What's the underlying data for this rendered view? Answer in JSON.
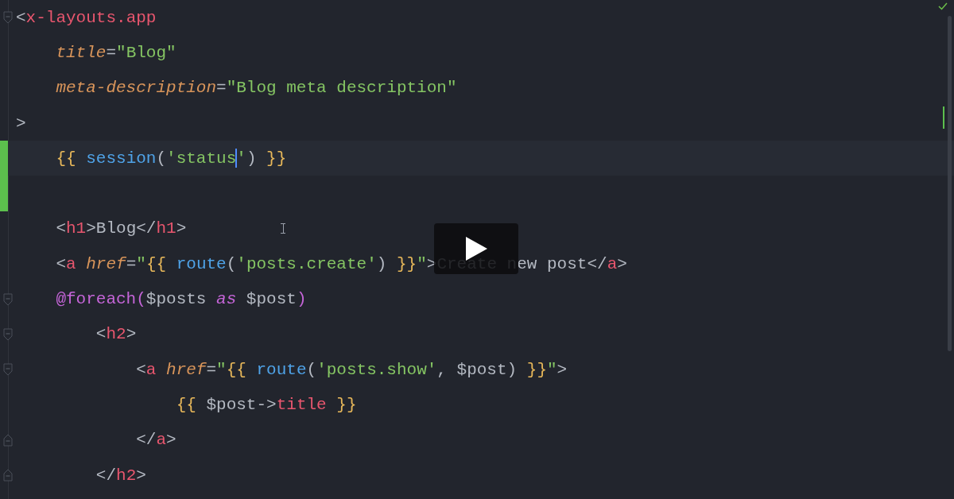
{
  "editor": {
    "lines": [
      {
        "current": false,
        "modified": false,
        "fold_start": true,
        "fold_end": false,
        "tokens": [
          {
            "kind": "punct",
            "text": "<"
          },
          {
            "kind": "tag",
            "text": "x-layouts.app"
          }
        ]
      },
      {
        "current": false,
        "modified": false,
        "fold_start": false,
        "fold_end": false,
        "tokens": [
          {
            "kind": "attr",
            "text": "    title"
          },
          {
            "kind": "punct",
            "text": "="
          },
          {
            "kind": "string",
            "text": "\"Blog\""
          }
        ]
      },
      {
        "current": false,
        "modified": false,
        "fold_start": false,
        "fold_end": false,
        "tokens": [
          {
            "kind": "attr",
            "text": "    meta-description"
          },
          {
            "kind": "punct",
            "text": "="
          },
          {
            "kind": "string",
            "text": "\"Blog meta description\""
          }
        ]
      },
      {
        "current": false,
        "modified": false,
        "fold_start": false,
        "fold_end": false,
        "tokens": [
          {
            "kind": "punct",
            "text": ">"
          }
        ]
      },
      {
        "current": true,
        "modified": true,
        "fold_start": false,
        "fold_end": false,
        "tokens": [
          {
            "kind": "brace",
            "text": "    {{ "
          },
          {
            "kind": "func",
            "text": "session"
          },
          {
            "kind": "punct",
            "text": "("
          },
          {
            "kind": "string",
            "text": "'status"
          },
          {
            "kind": "string",
            "text": "'",
            "cursor_before": true
          },
          {
            "kind": "punct",
            "text": ") "
          },
          {
            "kind": "brace",
            "text": "}}"
          }
        ]
      },
      {
        "current": false,
        "modified": true,
        "fold_start": false,
        "fold_end": false
      },
      {
        "current": false,
        "modified": false,
        "fold_start": false,
        "fold_end": false,
        "tokens": [
          {
            "kind": "punct",
            "text": "    <"
          },
          {
            "kind": "tag",
            "text": "h1"
          },
          {
            "kind": "punct",
            "text": ">Blog</"
          },
          {
            "kind": "tag",
            "text": "h1"
          },
          {
            "kind": "punct",
            "text": ">"
          }
        ]
      },
      {
        "current": false,
        "modified": false,
        "fold_start": false,
        "fold_end": false,
        "tokens": [
          {
            "kind": "punct",
            "text": "    <"
          },
          {
            "kind": "tag",
            "text": "a "
          },
          {
            "kind": "attr",
            "text": "href"
          },
          {
            "kind": "punct",
            "text": "="
          },
          {
            "kind": "string",
            "text": "\""
          },
          {
            "kind": "brace",
            "text": "{{ "
          },
          {
            "kind": "func",
            "text": "route"
          },
          {
            "kind": "punct",
            "text": "("
          },
          {
            "kind": "string",
            "text": "'posts.create'"
          },
          {
            "kind": "punct",
            "text": ") "
          },
          {
            "kind": "brace",
            "text": "}}"
          },
          {
            "kind": "string",
            "text": "\""
          },
          {
            "kind": "punct",
            "text": ">Create new post</"
          },
          {
            "kind": "tag",
            "text": "a"
          },
          {
            "kind": "punct",
            "text": ">"
          }
        ]
      },
      {
        "current": false,
        "modified": false,
        "fold_start": true,
        "fold_end": false,
        "tokens": [
          {
            "kind": "directive",
            "text": "    @foreach("
          },
          {
            "kind": "punct",
            "text": "$posts "
          },
          {
            "kind": "keyword",
            "text": "as"
          },
          {
            "kind": "punct",
            "text": " $post"
          },
          {
            "kind": "directive",
            "text": ")"
          }
        ]
      },
      {
        "current": false,
        "modified": false,
        "fold_start": true,
        "fold_end": false,
        "tokens": [
          {
            "kind": "punct",
            "text": "        <"
          },
          {
            "kind": "tag",
            "text": "h2"
          },
          {
            "kind": "punct",
            "text": ">"
          }
        ]
      },
      {
        "current": false,
        "modified": false,
        "fold_start": true,
        "fold_end": false,
        "tokens": [
          {
            "kind": "punct",
            "text": "            <"
          },
          {
            "kind": "tag",
            "text": "a "
          },
          {
            "kind": "attr",
            "text": "href"
          },
          {
            "kind": "punct",
            "text": "="
          },
          {
            "kind": "string",
            "text": "\""
          },
          {
            "kind": "brace",
            "text": "{{ "
          },
          {
            "kind": "func",
            "text": "route"
          },
          {
            "kind": "punct",
            "text": "("
          },
          {
            "kind": "string",
            "text": "'posts.show'"
          },
          {
            "kind": "punct",
            "text": ", $post) "
          },
          {
            "kind": "brace",
            "text": "}}"
          },
          {
            "kind": "string",
            "text": "\""
          },
          {
            "kind": "punct",
            "text": ">"
          }
        ]
      },
      {
        "current": false,
        "modified": false,
        "fold_start": false,
        "fold_end": false,
        "tokens": [
          {
            "kind": "brace",
            "text": "                {{ "
          },
          {
            "kind": "punct",
            "text": "$post->"
          },
          {
            "kind": "tag",
            "text": "title"
          },
          {
            "kind": "brace",
            "text": " }}"
          }
        ]
      },
      {
        "current": false,
        "modified": false,
        "fold_start": false,
        "fold_end": true,
        "tokens": [
          {
            "kind": "punct",
            "text": "            </"
          },
          {
            "kind": "tag",
            "text": "a"
          },
          {
            "kind": "punct",
            "text": ">"
          }
        ]
      },
      {
        "current": false,
        "modified": false,
        "fold_start": false,
        "fold_end": true,
        "tokens": [
          {
            "kind": "punct",
            "text": "        </"
          },
          {
            "kind": "tag",
            "text": "h2"
          },
          {
            "kind": "punct",
            "text": ">"
          }
        ]
      }
    ]
  }
}
